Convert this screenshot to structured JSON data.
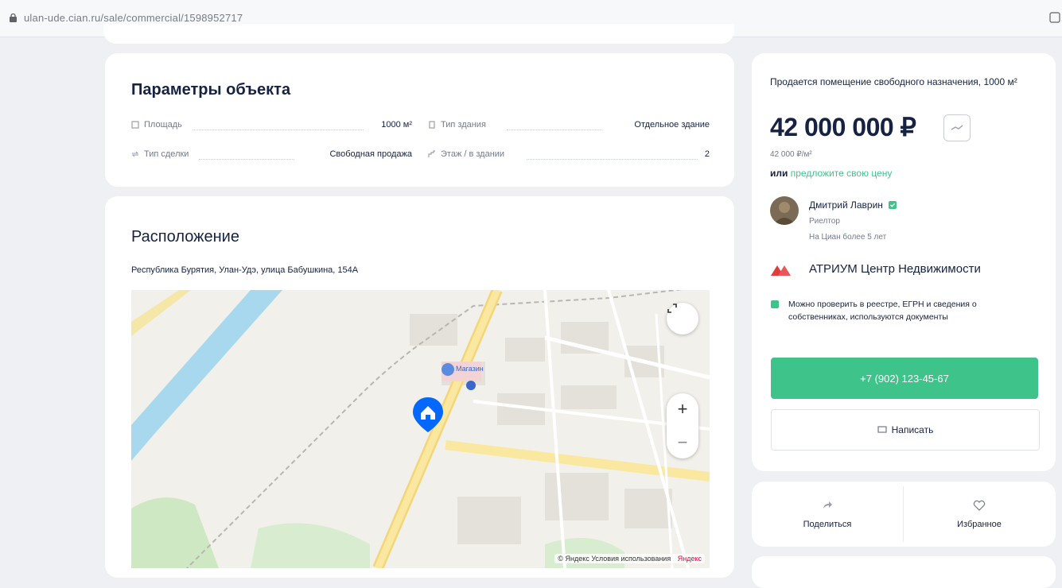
{
  "browser": {
    "url": "ulan-ude.cian.ru/sale/commercial/1598952717"
  },
  "params": {
    "title": "Параметры объекта",
    "rows": [
      {
        "label": "Площадь",
        "value": "1000 м²"
      },
      {
        "label": "Тип здания",
        "value": "Отдельное здание"
      },
      {
        "label": "Тип сделки",
        "value": "Свободная продажа"
      },
      {
        "label": "Этаж / в здании",
        "value": "2"
      }
    ]
  },
  "location": {
    "title": "Расположение",
    "address": "Республика Бурятия, Улан-Удэ, улица Бабушкина, 154А",
    "map_footer": "© Яндекс Условия использования",
    "map_brand": "Яндекс",
    "zoom_in": "+",
    "zoom_out": "−",
    "poi_label": "Магазин"
  },
  "sidebar": {
    "title": "Продается помещение свободного назначения, 1000 м²",
    "price": "42 000 000 ₽",
    "price_per_m": "42 000 ₽/м²",
    "offer_prefix": "или",
    "offer_link": "предложите свою цену",
    "agent": {
      "name": "Дмитрий Лаврин",
      "role": "Риелтор",
      "experience": "На Циан более 5 лет"
    },
    "agency": "АТРИУМ Центр Недвижимости",
    "notice": "Можно проверить в реестре, ЕГРН и сведения о собственниках, используются документы",
    "phone": "+7 (902) 123-45-67",
    "write_label": "Написать"
  },
  "actions": {
    "share_label": "Поделиться",
    "favorite_label": "Избранное"
  },
  "colors": {
    "accent_green": "#3ec48a",
    "pin_blue": "#0468ff",
    "text_dark": "#152242"
  }
}
